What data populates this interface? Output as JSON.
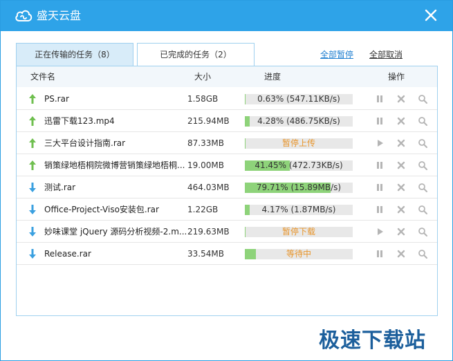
{
  "window": {
    "title": "盛天云盘"
  },
  "tabs": [
    {
      "label": "正在传输的任务（8）",
      "active": true
    },
    {
      "label": "已完成的任务（2）",
      "active": false
    }
  ],
  "actions": {
    "pause_all": "全部暂停",
    "cancel_all": "全部取消"
  },
  "columns": {
    "name": "文件名",
    "size": "大小",
    "progress": "进度",
    "ops": "操作"
  },
  "rows": [
    {
      "direction": "upload",
      "name": "PS.rar",
      "size": "1.58GB",
      "percent": 0.63,
      "text": "0.63% (547.11KB/s)",
      "status": false,
      "play": false
    },
    {
      "direction": "upload",
      "name": "迅雷下载123.mp4",
      "size": "215.94MB",
      "percent": 4.28,
      "text": "4.28% (486.75KB/s)",
      "status": false,
      "play": false
    },
    {
      "direction": "upload",
      "name": "三大平台设计指南.rar",
      "size": "87.33MB",
      "percent": 0.5,
      "text": "暂停上传",
      "status": true,
      "play": true
    },
    {
      "direction": "upload",
      "name": "销策绿地梧桐院微博营销策绿地梧桐...",
      "size": "19.00MB",
      "percent": 41.45,
      "text": "41.45% (472.73KB/s)",
      "status": false,
      "play": false
    },
    {
      "direction": "download",
      "name": "测试.rar",
      "size": "464.03MB",
      "percent": 79.71,
      "text": "79.71% (15.89MB/s)",
      "status": false,
      "play": false
    },
    {
      "direction": "download",
      "name": "Office-Project-Viso安装包.rar",
      "size": "1.22GB",
      "percent": 4.17,
      "text": "4.17% (1.87MB/s)",
      "status": false,
      "play": false
    },
    {
      "direction": "download",
      "name": "妙味课堂 jQuery 源码分析视频-2.m...",
      "size": "219.63MB",
      "percent": 0.5,
      "text": "暂停下载",
      "status": true,
      "play": true
    },
    {
      "direction": "download",
      "name": "Release.rar",
      "size": "33.54MB",
      "percent": 10,
      "text": "等待中",
      "status": true,
      "play": false
    }
  ],
  "watermark": "极速下载站",
  "colors": {
    "titlebar": "#2ea3e8",
    "upload_arrow": "#6fbf4f",
    "download_arrow": "#3aa0e0",
    "progress_fill": "#8ed37a",
    "status_text": "#e8952b"
  }
}
